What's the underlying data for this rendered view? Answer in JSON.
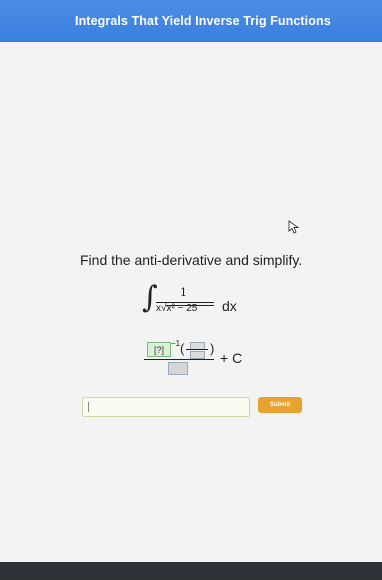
{
  "header": {
    "title": "Integrals That Yield Inverse Trig Functions"
  },
  "problem": {
    "prompt": "Find the anti-derivative and simplify.",
    "integral": {
      "sign": "∫",
      "numerator": "1",
      "denominator": "x√x² − 25",
      "differential": "dx"
    },
    "answer_template": {
      "box_placeholder": "?",
      "exponent": "−1",
      "open_paren": "(",
      "close_paren": ")",
      "constant": "+ C"
    }
  },
  "answer_input": {
    "value": ""
  },
  "submit_button": {
    "label": "Submit"
  },
  "colors": {
    "header": "#3f86e0",
    "submit": "#e8a22f",
    "bottom_bar": "#2f3237"
  }
}
